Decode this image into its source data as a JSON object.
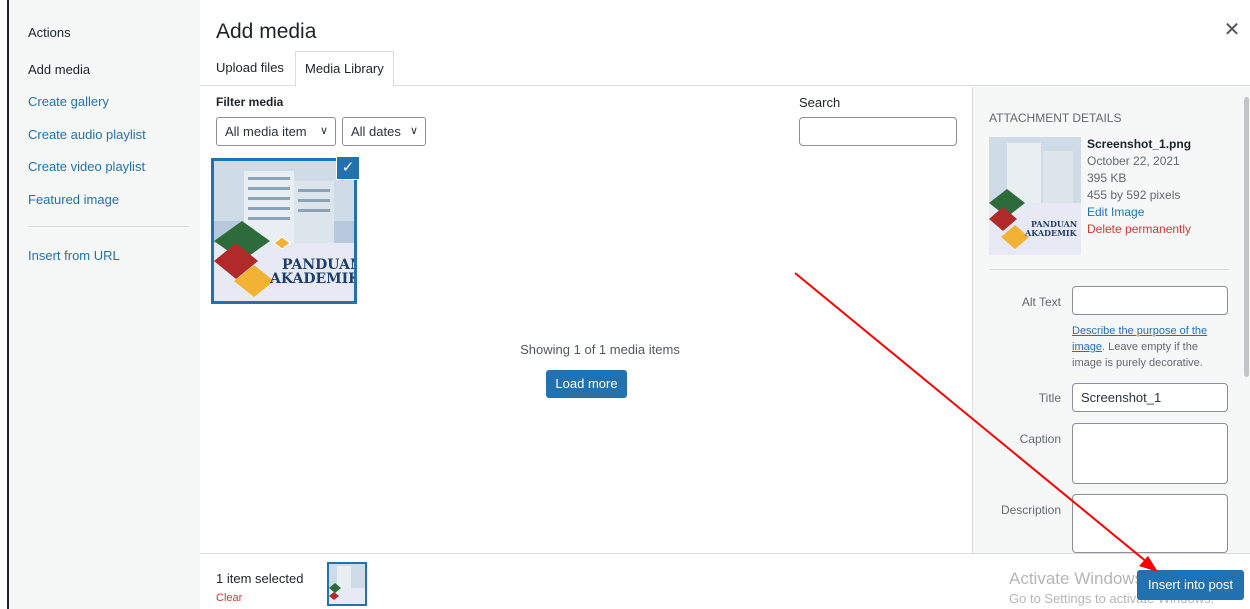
{
  "sidebar": {
    "heading": "Actions",
    "items": [
      {
        "label": "Add media"
      },
      {
        "label": "Create gallery"
      },
      {
        "label": "Create audio playlist"
      },
      {
        "label": "Create video playlist"
      },
      {
        "label": "Featured image"
      },
      {
        "label": "Insert from URL"
      }
    ]
  },
  "header": {
    "title": "Add media",
    "close_icon": "close-icon"
  },
  "tabs": [
    {
      "label": "Upload files"
    },
    {
      "label": "Media Library"
    }
  ],
  "toolbar": {
    "filter_label": "Filter media",
    "type_select": "All media item",
    "date_select": "All dates",
    "search_label": "Search",
    "search_value": ""
  },
  "grid": {
    "thumbnail_text_1": "PANDUAN",
    "thumbnail_text_2": "AKADEMIK",
    "showing_text": "Showing 1 of 1 media items",
    "load_more": "Load more"
  },
  "details": {
    "heading": "Attachment Details",
    "filename": "Screenshot_1.png",
    "date": "October 22, 2021",
    "size": "395 KB",
    "dimensions": "455 by 592 pixels",
    "edit": "Edit Image",
    "delete": "Delete permanently",
    "alt_label": "Alt Text",
    "alt_value": "",
    "alt_help_link": "Describe the purpose of the image",
    "alt_help_rest": ". Leave empty if the image is purely decorative.",
    "title_label": "Title",
    "title_value": "Screenshot_1",
    "caption_label": "Caption",
    "caption_value": "",
    "description_label": "Description",
    "description_value": ""
  },
  "bottom": {
    "selected": "1 item selected",
    "clear": "Clear",
    "insert": "Insert into post",
    "watermark_line1": "Activate Windows",
    "watermark_line2": "Go to Settings to activate Windows."
  },
  "colors": {
    "accent": "#2271b1",
    "danger": "#d63638",
    "arrow": "#ff0000"
  }
}
